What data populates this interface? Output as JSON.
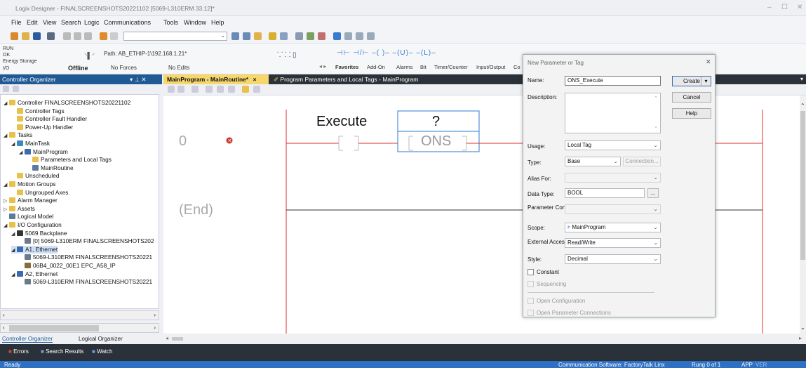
{
  "window": {
    "title": "Logix Designer - FINALSCREENSHOTS20221102 [5069-L310ERM 33.12]*"
  },
  "menu": [
    "File",
    "Edit",
    "View",
    "Search",
    "Logic",
    "Communications",
    "Tools",
    "Window",
    "Help"
  ],
  "status": {
    "modes": [
      "RUN",
      "OK",
      "Energy Storage",
      "I/O"
    ],
    "mode_state": "Offline",
    "forces": "No Forces",
    "edits": "No Edits",
    "path": "Path: AB_ETHIP-1\\192.168.1.21*"
  },
  "instr_toolbar": {
    "tabs": [
      "Favorites",
      "Add-On",
      "Alarms",
      "Bit",
      "Timer/Counter",
      "Input/Output",
      "Co"
    ],
    "symbols": [
      "⊣⊢",
      "⊣/⊢",
      "–( )–",
      "–(U)–",
      "–(L)–"
    ]
  },
  "controller_organizer": {
    "title": "Controller Organizer",
    "pin": "▾ ⊥ ✕",
    "tree": [
      {
        "label": "Controller FINALSCREENSHOTS20221102",
        "depth": 0,
        "icon": "folder-icon",
        "expand": "◢"
      },
      {
        "label": "Controller Tags",
        "depth": 1,
        "icon": "tag-icon",
        "expand": ""
      },
      {
        "label": "Controller Fault Handler",
        "depth": 1,
        "icon": "folder-icon",
        "expand": ""
      },
      {
        "label": "Power-Up Handler",
        "depth": 1,
        "icon": "folder-icon",
        "expand": ""
      },
      {
        "label": "Tasks",
        "depth": 0,
        "icon": "folder-icon",
        "expand": "◢"
      },
      {
        "label": "MainTask",
        "depth": 1,
        "icon": "task-icon",
        "expand": "◢"
      },
      {
        "label": "MainProgram",
        "depth": 2,
        "icon": "program-icon",
        "expand": "◢"
      },
      {
        "label": "Parameters and Local Tags",
        "depth": 3,
        "icon": "tag-icon",
        "expand": ""
      },
      {
        "label": "MainRoutine",
        "depth": 3,
        "icon": "routine-icon",
        "expand": ""
      },
      {
        "label": "Unscheduled",
        "depth": 1,
        "icon": "folder-icon",
        "expand": ""
      },
      {
        "label": "Motion Groups",
        "depth": 0,
        "icon": "folder-icon",
        "expand": "◢"
      },
      {
        "label": "Ungrouped Axes",
        "depth": 1,
        "icon": "folder-icon",
        "expand": ""
      },
      {
        "label": "Alarm Manager",
        "depth": 0,
        "icon": "folder-icon",
        "expand": "▷"
      },
      {
        "label": "Assets",
        "depth": 0,
        "icon": "folder-icon",
        "expand": "▷"
      },
      {
        "label": "Logical Model",
        "depth": 0,
        "icon": "model-icon",
        "expand": ""
      },
      {
        "label": "I/O Configuration",
        "depth": 0,
        "icon": "folder-icon",
        "expand": "◢"
      },
      {
        "label": "5069 Backplane",
        "depth": 1,
        "icon": "backplane-icon",
        "expand": "◢"
      },
      {
        "label": "[0] 5069-L310ERM FINALSCREENSHOTS202",
        "depth": 2,
        "icon": "module-icon",
        "expand": ""
      },
      {
        "label": "A1, Ethernet",
        "depth": 1,
        "icon": "network-icon",
        "expand": "◢"
      },
      {
        "label": "5069-L310ERM FINALSCREENSHOTS20221",
        "depth": 2,
        "icon": "module-icon",
        "expand": ""
      },
      {
        "label": "06B4_0022_00E1 EPC_A58_IP",
        "depth": 2,
        "icon": "device-icon",
        "expand": ""
      },
      {
        "label": "A2, Ethernet",
        "depth": 1,
        "icon": "network-icon",
        "expand": "◢"
      },
      {
        "label": "5069-L310ERM FINALSCREENSHOTS20221",
        "depth": 2,
        "icon": "module-icon",
        "expand": ""
      }
    ],
    "tabs": [
      "Controller Organizer",
      "Logical Organizer"
    ]
  },
  "editor_tabs": [
    {
      "label": "MainProgram - MainRoutine*",
      "close": "×"
    },
    {
      "label": "Program Parameters and Local Tags - MainProgram",
      "close": ""
    }
  ],
  "ladder": {
    "rung_number": "0",
    "end_label": "(End)",
    "contact_tag": "Execute",
    "ons_tag": "?",
    "ons_label": "ONS"
  },
  "dialog": {
    "title": "New Parameter or Tag",
    "close": "✕",
    "name_label": "Name:",
    "name_value": "ONS_Execute",
    "description_label": "Description:",
    "usage_label": "Usage:",
    "usage_value": "Local Tag",
    "type_label": "Type:",
    "type_value": "Base",
    "connection_button": "Connection...",
    "alias_label": "Alias For:",
    "datatype_label": "Data Type:",
    "datatype_value": "BOOL",
    "browse_button": "...",
    "param_conn_label": "Parameter Connection:",
    "scope_label": "Scope:",
    "scope_value": "MainProgram",
    "external_label": "External Access:",
    "external_value": "Read/Write",
    "style_label": "Style:",
    "style_value": "Decimal",
    "constant_label": "Constant",
    "sequencing_label": "Sequencing",
    "open_config_label": "Open Configuration",
    "open_param_label": "Open Parameter Connections",
    "create_button": "Create",
    "cancel_button": "Cancel",
    "help_button": "Help"
  },
  "bottom_tabs": [
    "Errors",
    "Search Results",
    "Watch"
  ],
  "statusbar": {
    "ready": "Ready",
    "comm": "Communication Software: FactoryTalk Linx",
    "rung": "Rung 0 of 1",
    "app": "APP",
    "ver": "VER"
  },
  "colors": {
    "accent": "#1f5a95",
    "rung_red": "#e03030",
    "ons_border": "#2d7ad4",
    "statusbar": "#2e71c4"
  }
}
